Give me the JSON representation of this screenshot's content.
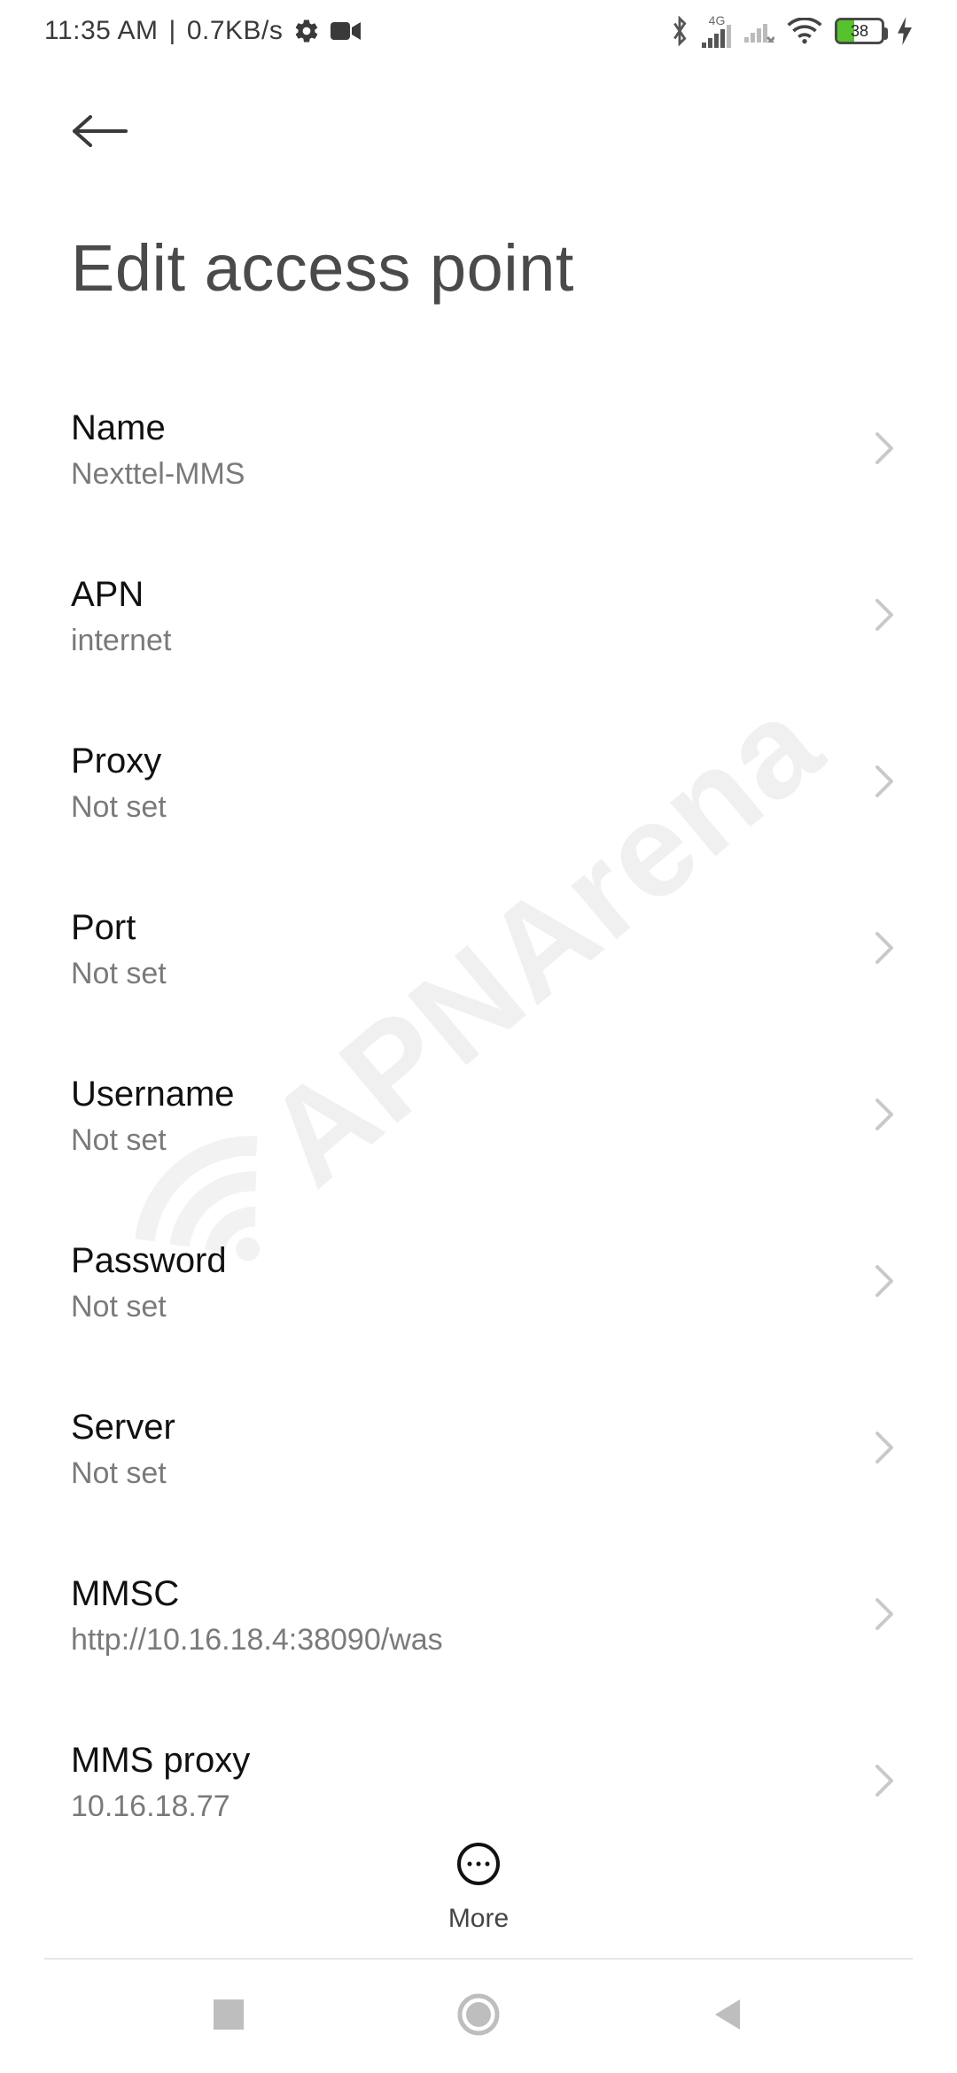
{
  "status": {
    "time": "11:35 AM",
    "separator": "|",
    "net_speed": "0.7KB/s",
    "signal1_label": "4G",
    "battery_pct": 38,
    "battery_text": "38"
  },
  "page": {
    "title": "Edit access point"
  },
  "settings": [
    {
      "label": "Name",
      "value": "Nexttel-MMS"
    },
    {
      "label": "APN",
      "value": "internet"
    },
    {
      "label": "Proxy",
      "value": "Not set"
    },
    {
      "label": "Port",
      "value": "Not set"
    },
    {
      "label": "Username",
      "value": "Not set"
    },
    {
      "label": "Password",
      "value": "Not set"
    },
    {
      "label": "Server",
      "value": "Not set"
    },
    {
      "label": "MMSC",
      "value": "http://10.16.18.4:38090/was"
    },
    {
      "label": "MMS proxy",
      "value": "10.16.18.77"
    }
  ],
  "action_bar": {
    "more_label": "More"
  },
  "watermark": {
    "text": "APNArena"
  }
}
